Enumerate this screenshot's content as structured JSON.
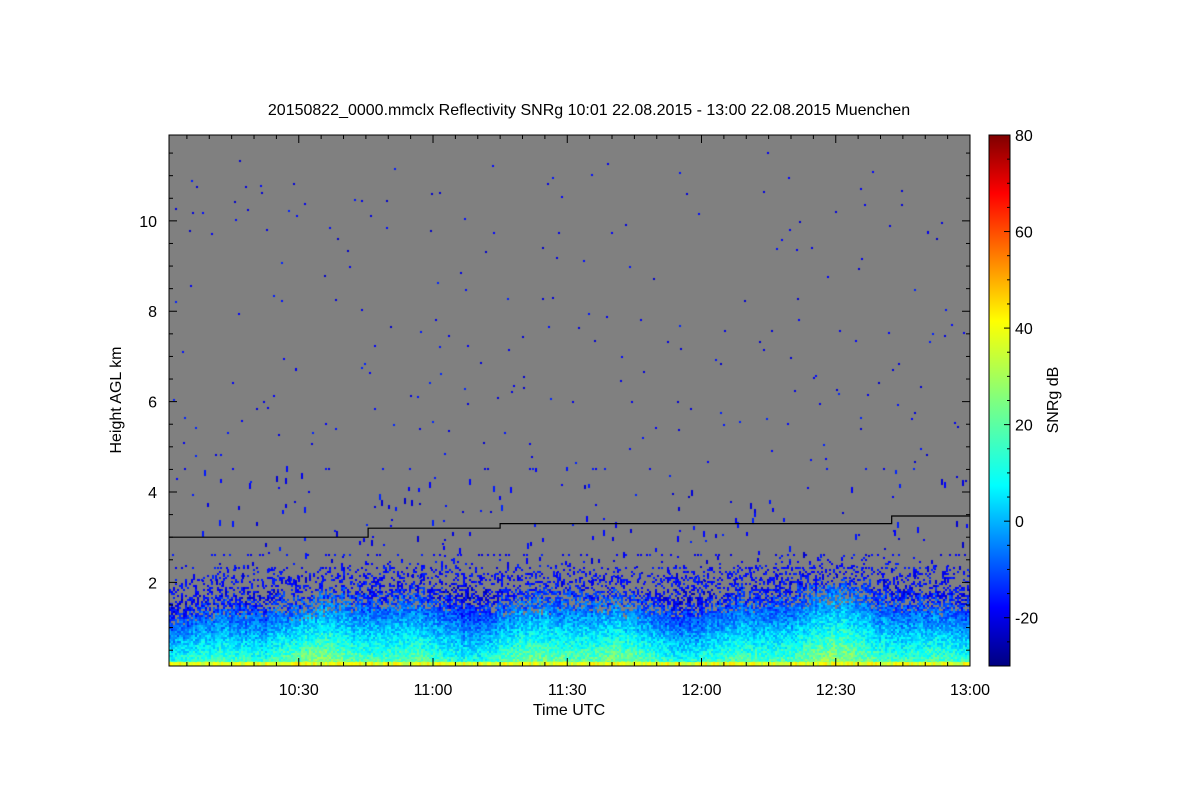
{
  "chart_data": {
    "type": "heatmap",
    "title": "20150822_0000.mmclx Reflectivity SNRg   10:01 22.08.2015 - 13:00 22.08.2015 Muenchen",
    "xlabel": "Time UTC",
    "ylabel": "Height AGL km",
    "x_ticks": [
      "10:30",
      "11:00",
      "11:30",
      "12:00",
      "12:30",
      "13:00"
    ],
    "x_tick_values": [
      630,
      660,
      690,
      720,
      750,
      780
    ],
    "xlim": [
      601,
      780
    ],
    "y_ticks": [
      "2",
      "4",
      "6",
      "8",
      "10"
    ],
    "y_tick_values": [
      2,
      4,
      6,
      8,
      10
    ],
    "ylim": [
      0.15,
      11.9
    ],
    "colorbar": {
      "label": "SNRg dB",
      "ticks": [
        "-20",
        "0",
        "20",
        "40",
        "60",
        "80"
      ],
      "tick_values": [
        -20,
        0,
        20,
        40,
        60,
        80
      ],
      "range": [
        -30,
        80
      ],
      "colormap": "jet"
    },
    "background_color": "#808080",
    "line_series": {
      "x": [
        601,
        645.5,
        645.5,
        675,
        675,
        762.5,
        762.5,
        780
      ],
      "y": [
        3.0,
        3.0,
        3.2,
        3.2,
        3.3,
        3.3,
        3.47,
        3.47
      ],
      "color": "#000000"
    },
    "echo_layer": {
      "dense_top_km": [
        1.5,
        1.75,
        1.65,
        1.85,
        1.95,
        1.8,
        1.85,
        1.7,
        1.75,
        1.95,
        2.0,
        1.9,
        1.75
      ],
      "dense_top_x": [
        601,
        615,
        630,
        640,
        655,
        670,
        690,
        705,
        720,
        735,
        750,
        765,
        780
      ]
    }
  }
}
